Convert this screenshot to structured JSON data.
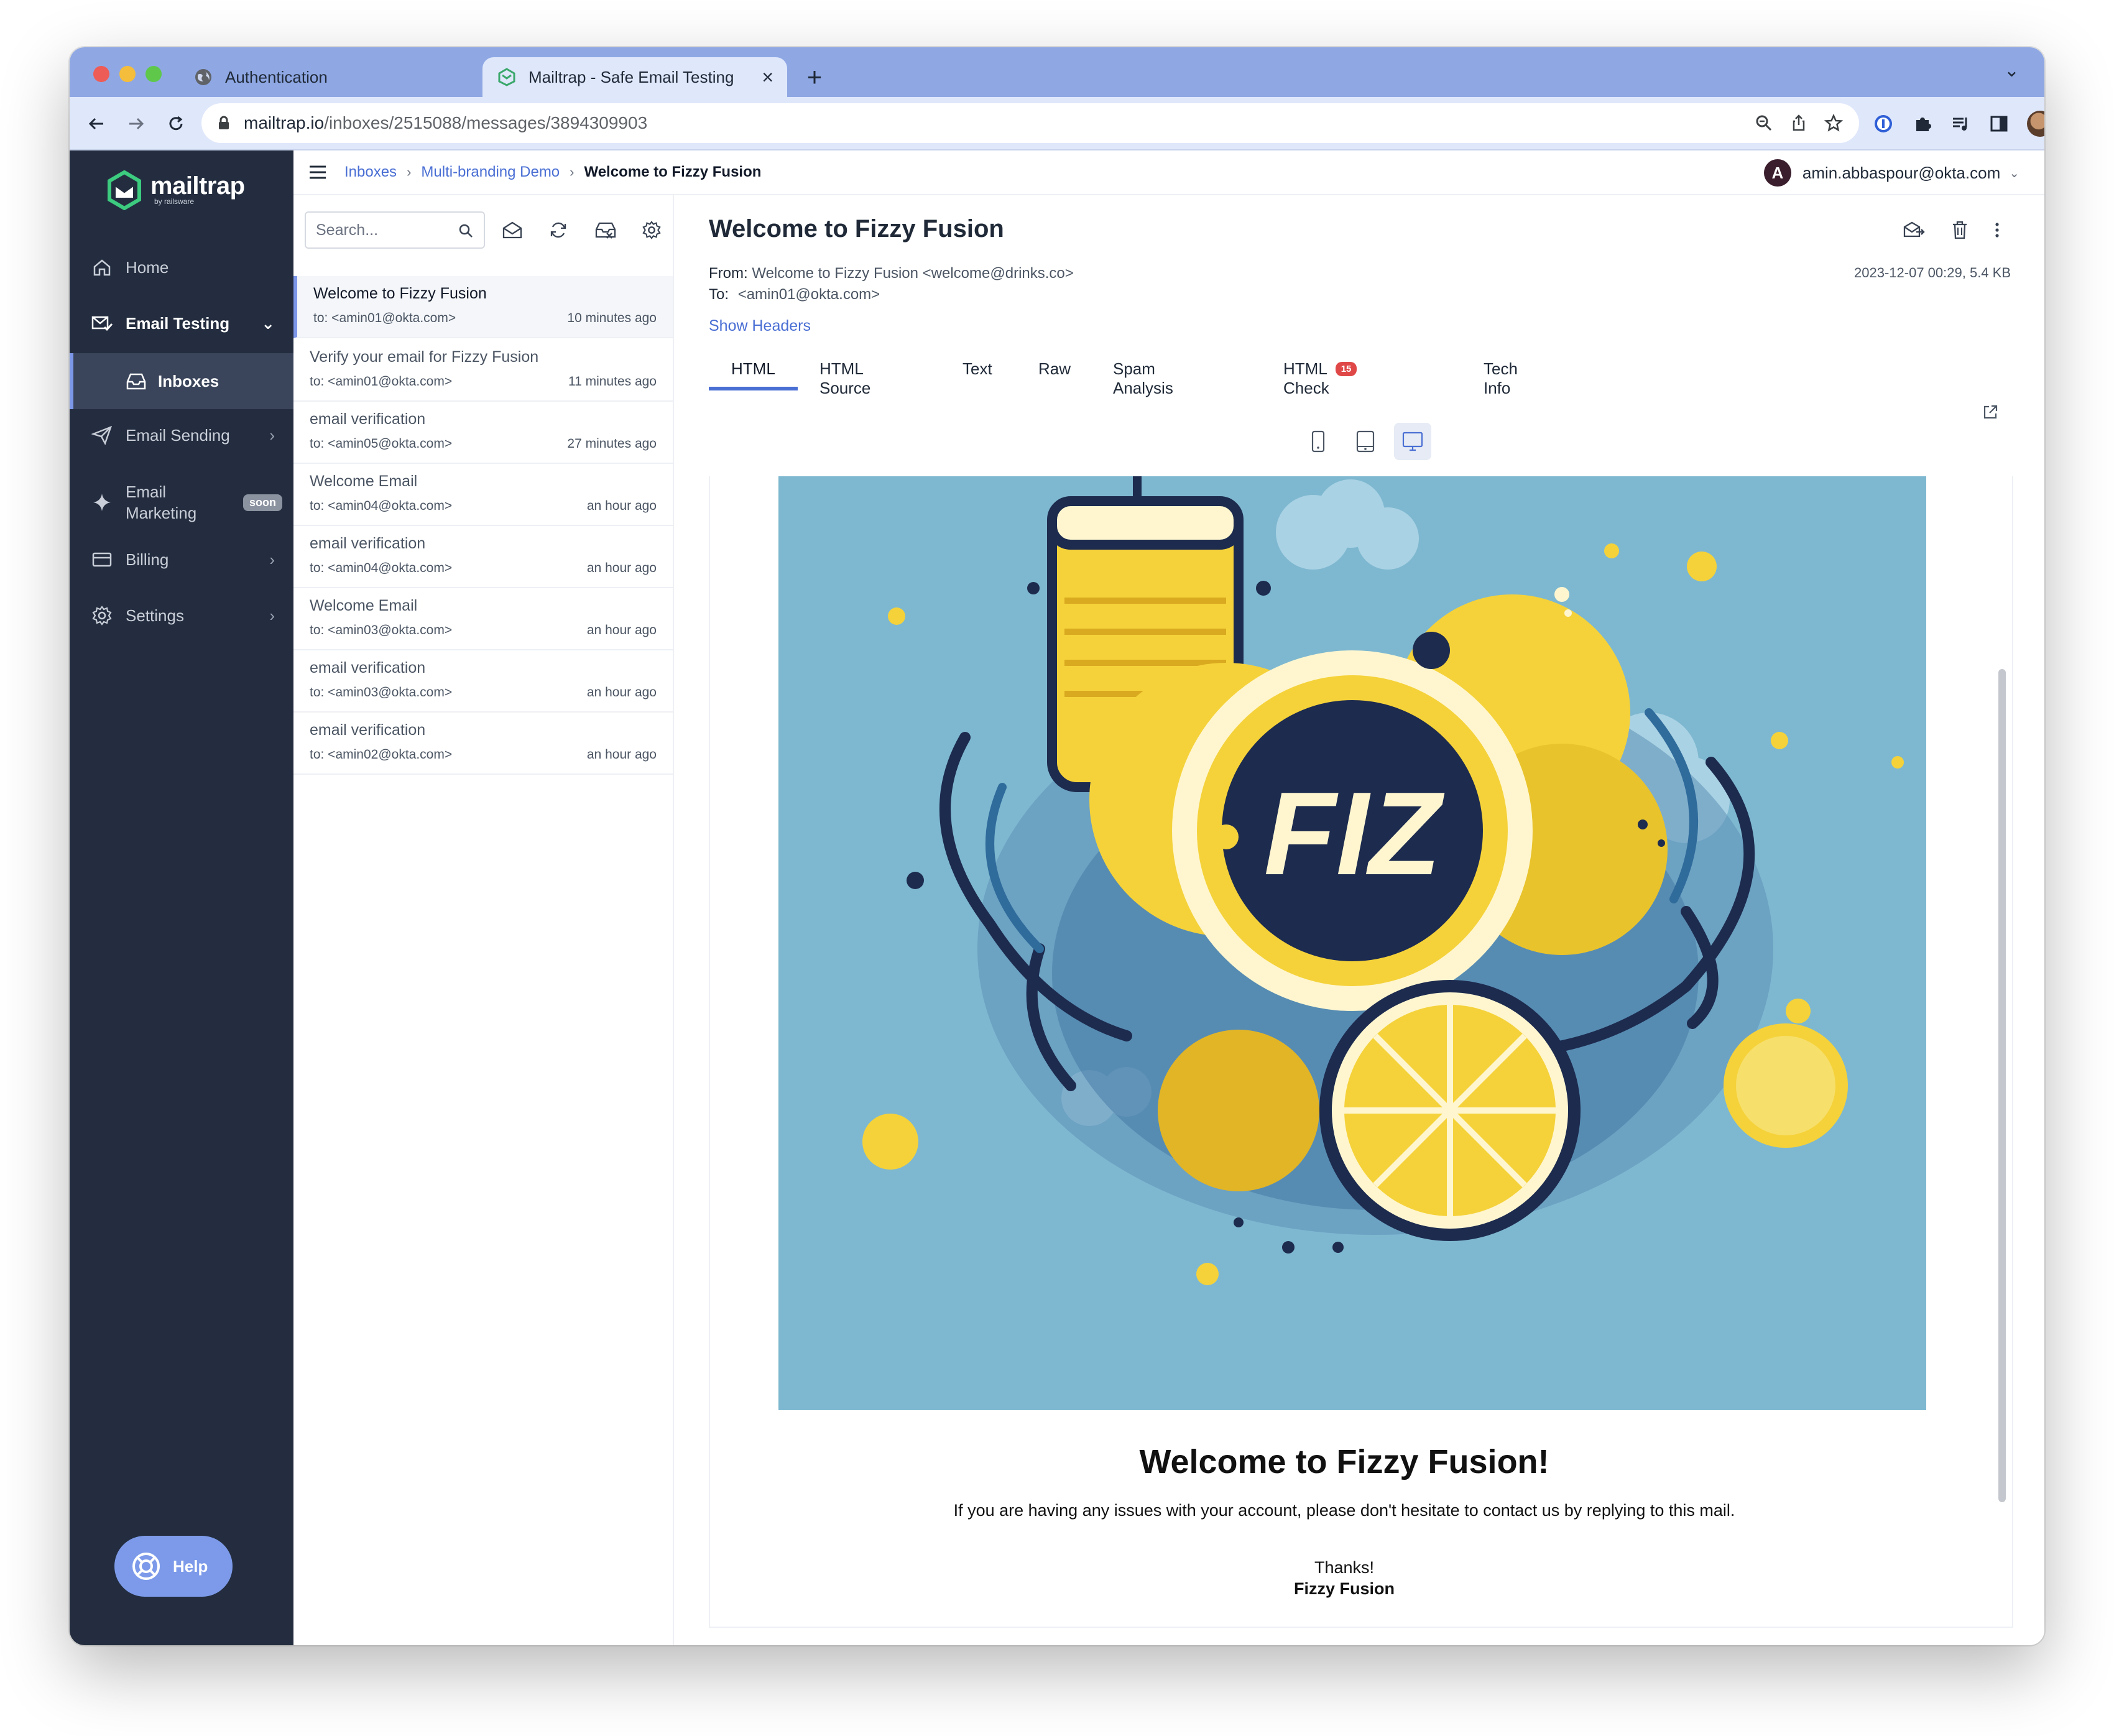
{
  "browser": {
    "tabs": [
      {
        "title": "Authentication",
        "active": false
      },
      {
        "title": "Mailtrap - Safe Email Testing",
        "active": true
      }
    ],
    "url_host": "mailtrap.io",
    "url_path": "/inboxes/2515088/messages/3894309903"
  },
  "app": {
    "logo_name": "mailtrap",
    "logo_by": "by railsware",
    "sidebar": {
      "home": "Home",
      "email_testing": "Email Testing",
      "inboxes": "Inboxes",
      "email_sending": "Email Sending",
      "email_marketing_line1": "Email",
      "email_marketing_line2": "Marketing",
      "soon_badge": "soon",
      "billing": "Billing",
      "settings": "Settings",
      "help": "Help"
    },
    "breadcrumb": {
      "inboxes": "Inboxes",
      "project": "Multi-branding Demo",
      "current": "Welcome to Fizzy Fusion"
    },
    "user": {
      "initial": "A",
      "email": "amin.abbaspour@okta.com"
    }
  },
  "list": {
    "search_placeholder": "Search...",
    "messages": [
      {
        "subject": "Welcome to Fizzy Fusion",
        "to": "to: <amin01@okta.com>",
        "time": "10 minutes ago",
        "selected": true
      },
      {
        "subject": "Verify your email for Fizzy Fusion",
        "to": "to: <amin01@okta.com>",
        "time": "11 minutes ago"
      },
      {
        "subject": "email verification",
        "to": "to: <amin05@okta.com>",
        "time": "27 minutes ago"
      },
      {
        "subject": "Welcome Email",
        "to": "to: <amin04@okta.com>",
        "time": "an hour ago"
      },
      {
        "subject": "email verification",
        "to": "to: <amin04@okta.com>",
        "time": "an hour ago"
      },
      {
        "subject": "Welcome Email",
        "to": "to: <amin03@okta.com>",
        "time": "an hour ago"
      },
      {
        "subject": "email verification",
        "to": "to: <amin03@okta.com>",
        "time": "an hour ago"
      },
      {
        "subject": "email verification",
        "to": "to: <amin02@okta.com>",
        "time": "an hour ago"
      }
    ]
  },
  "detail": {
    "title": "Welcome to Fizzy Fusion",
    "from_label": "From:",
    "from_value": "Welcome to Fizzy Fusion <welcome@drinks.co>",
    "to_label": "To:",
    "to_value": "<amin01@okta.com>",
    "meta": "2023-12-07 00:29, 5.4 KB",
    "show_headers": "Show Headers",
    "tabs": {
      "html": "HTML",
      "html_source": "HTML Source",
      "text": "Text",
      "raw": "Raw",
      "spam": "Spam Analysis",
      "html_check": "HTML Check",
      "html_check_count": "15",
      "tech": "Tech Info"
    }
  },
  "email": {
    "logo_text": "FIZ",
    "heading": "Welcome to Fizzy Fusion!",
    "body": "If you are having any issues with your account, please don't hesitate to contact us by replying to this mail.",
    "thanks": "Thanks!",
    "signature": "Fizzy Fusion"
  },
  "colors": {
    "sidebar_bg": "#232d3f",
    "accent": "#4a6fd4",
    "hero_bg": "#7eb8d0",
    "lemon": "#f5d23a",
    "navy": "#1d2b4f"
  }
}
